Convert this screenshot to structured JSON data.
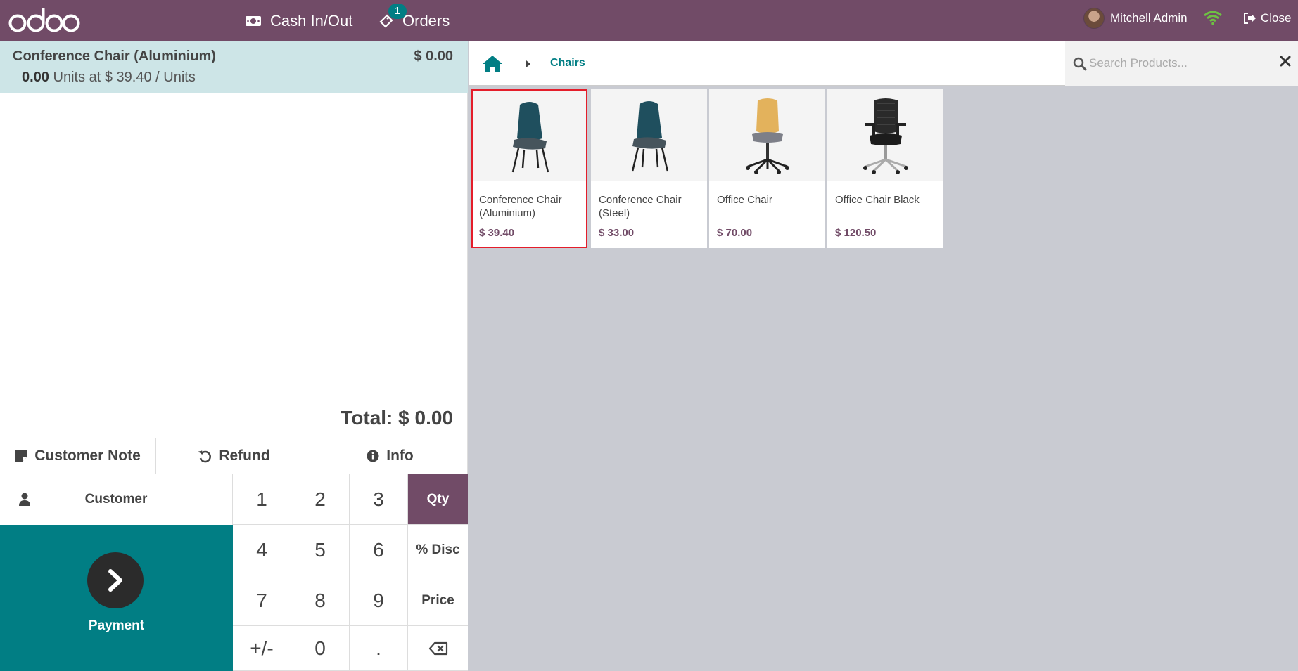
{
  "topbar": {
    "logo_text": "odoo",
    "cash_label": "Cash In/Out",
    "orders_label": "Orders",
    "orders_badge": "1",
    "user_name": "Mitchell Admin",
    "close_label": "Close"
  },
  "order": {
    "line_name": "Conference Chair (Aluminium)",
    "line_price": "$ 0.00",
    "line_qty": "0.00",
    "line_detail": "Units at $ 39.40 / Units",
    "total_label": "Total: $ 0.00"
  },
  "controls": {
    "customer_note": "Customer Note",
    "refund": "Refund",
    "info": "Info"
  },
  "customer_label": "Customer",
  "payment_label": "Payment",
  "numpad": {
    "k1": "1",
    "k2": "2",
    "k3": "3",
    "qty": "Qty",
    "k4": "4",
    "k5": "5",
    "k6": "6",
    "disc": "% Disc",
    "k7": "7",
    "k8": "8",
    "k9": "9",
    "price": "Price",
    "plusminus": "+/-",
    "k0": "0",
    "dot": ".",
    "active_mode": "Qty"
  },
  "breadcrumb": {
    "category": "Chairs"
  },
  "search": {
    "placeholder": "Search Products..."
  },
  "products": [
    {
      "name": "Conference Chair (Aluminium)",
      "price": "$ 39.40",
      "selected": true
    },
    {
      "name": "Conference Chair (Steel)",
      "price": "$ 33.00",
      "selected": false
    },
    {
      "name": "Office Chair",
      "price": "$ 70.00",
      "selected": false
    },
    {
      "name": "Office Chair Black",
      "price": "$ 120.50",
      "selected": false
    }
  ],
  "colors": {
    "brand": "#714b67",
    "teal": "#017e84",
    "selected_outline": "#e41d2a",
    "orderline_bg": "#cde5e7"
  }
}
